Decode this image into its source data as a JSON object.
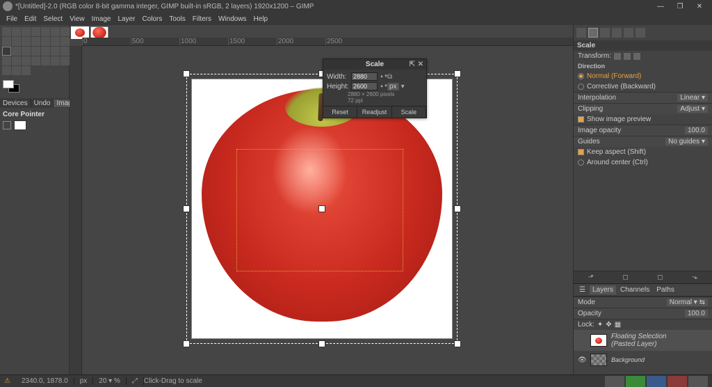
{
  "window": {
    "title": "*[Untitled]-2.0 (RGB color 8-bit gamma integer, GIMP built-in sRGB, 2 layers) 1920x1200 – GIMP",
    "minimize": "—",
    "maximize": "❐",
    "close": "✕"
  },
  "menubar": [
    "File",
    "Edit",
    "Select",
    "View",
    "Image",
    "Layer",
    "Colors",
    "Tools",
    "Filters",
    "Windows",
    "Help"
  ],
  "ruler_marks": [
    "0",
    "500",
    "1000",
    "1500",
    "2000",
    "2500"
  ],
  "dock_tabs": {
    "devices": "Devices",
    "undo": "Undo",
    "images": "Images"
  },
  "tool_options": {
    "title": "Core Pointer"
  },
  "scale_dialog": {
    "title": "Scale",
    "width_label": "Width:",
    "width_value": "2880",
    "height_label": "Height:",
    "height_value": "2600",
    "info": "2880 × 2600 pixels",
    "ppi": "72 ppi",
    "unit": "px",
    "btn_reset": "Reset",
    "btn_readjust": "Readjust",
    "btn_scale": "Scale"
  },
  "right_panel": {
    "scale_head": "Scale",
    "transform_label": "Transform:",
    "direction_label": "Direction",
    "dir_normal": "Normal (Forward)",
    "dir_corrective": "Corrective (Backward)",
    "interp_label": "Interpolation",
    "interp_value": "Linear",
    "clipping_label": "Clipping",
    "clipping_value": "Adjust",
    "preview": "Show image preview",
    "opacity_label": "Image opacity",
    "opacity_value": "100.0",
    "guides_label": "Guides",
    "guides_value": "No guides",
    "keep_aspect": "Keep aspect (Shift)",
    "around_center": "Around center (Ctrl)"
  },
  "layers": {
    "tabs": [
      "Layers",
      "Channels",
      "Paths"
    ],
    "mode_label": "Mode",
    "mode_value": "Normal",
    "opacity_label": "Opacity",
    "opacity_value": "100.0",
    "lock_label": "Lock:",
    "items": [
      {
        "name": "Floating Selection",
        "sub": "(Pasted Layer)",
        "visible": false
      },
      {
        "name": "Background",
        "sub": "",
        "visible": true
      }
    ]
  },
  "status": {
    "coords": "2340.0, 1878.0",
    "unit": "px",
    "zoom": "20",
    "zoom_pct": "%",
    "hint": "Click-Drag to scale"
  }
}
